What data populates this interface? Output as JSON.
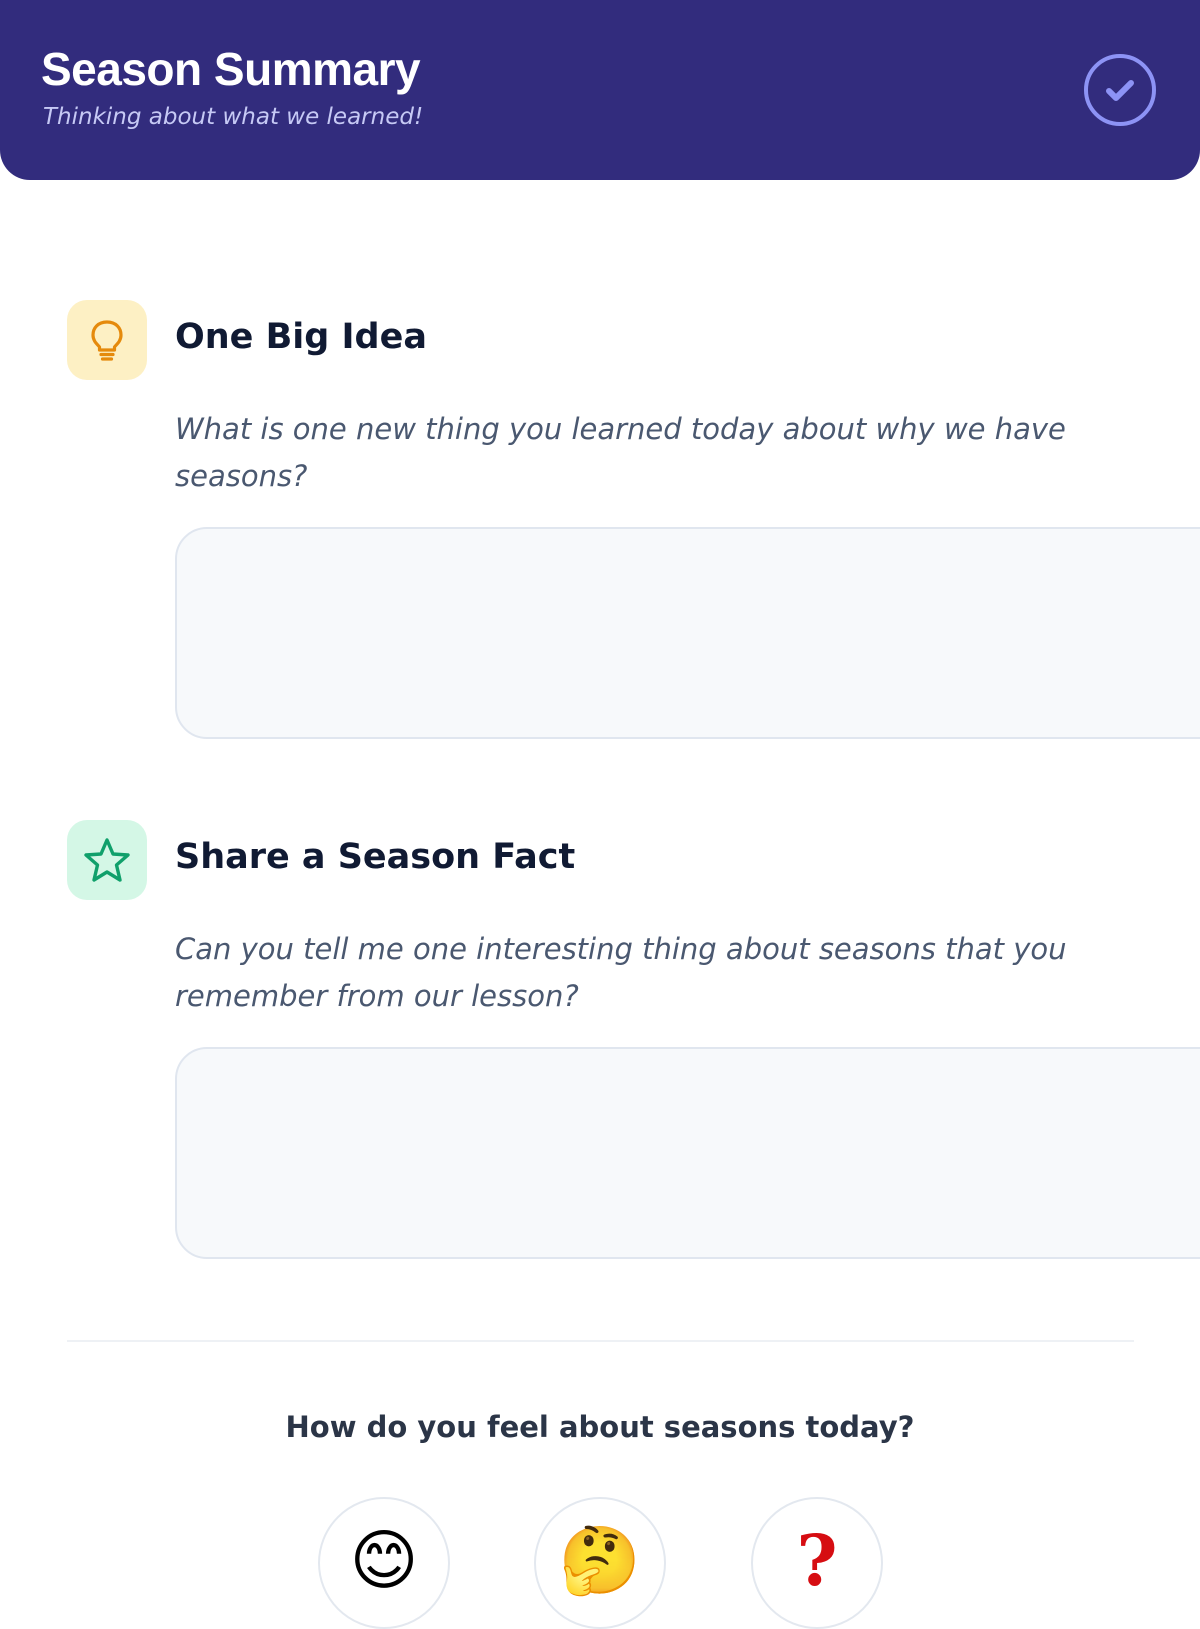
{
  "header": {
    "title": "Season Summary",
    "subtitle": "Thinking about what we learned!",
    "icon": "check-circle-icon",
    "background_color": "#322c7d"
  },
  "sections": [
    {
      "icon": "lightbulb-icon",
      "icon_color": "#e58a0c",
      "icon_background": "#fdf0c4",
      "title": "One Big Idea",
      "prompt": "What is one new thing you learned today about why we have seasons?",
      "answer_value": "",
      "answer_placeholder": ""
    },
    {
      "icon": "star-icon",
      "icon_color": "#10a06b",
      "icon_background": "#d4f7e6",
      "title": "Share a Season Fact",
      "prompt": "Can you tell me one interesting thing about seasons that you remember from our lesson?",
      "answer_value": "",
      "answer_placeholder": ""
    }
  ],
  "feelings": {
    "question": "How do you feel about seasons today?",
    "options": [
      {
        "icon": "smiling-face-icon",
        "glyph": "😊"
      },
      {
        "icon": "thinking-face-icon",
        "glyph": "🤔"
      },
      {
        "icon": "question-mark-icon",
        "glyph": "❓"
      }
    ]
  }
}
